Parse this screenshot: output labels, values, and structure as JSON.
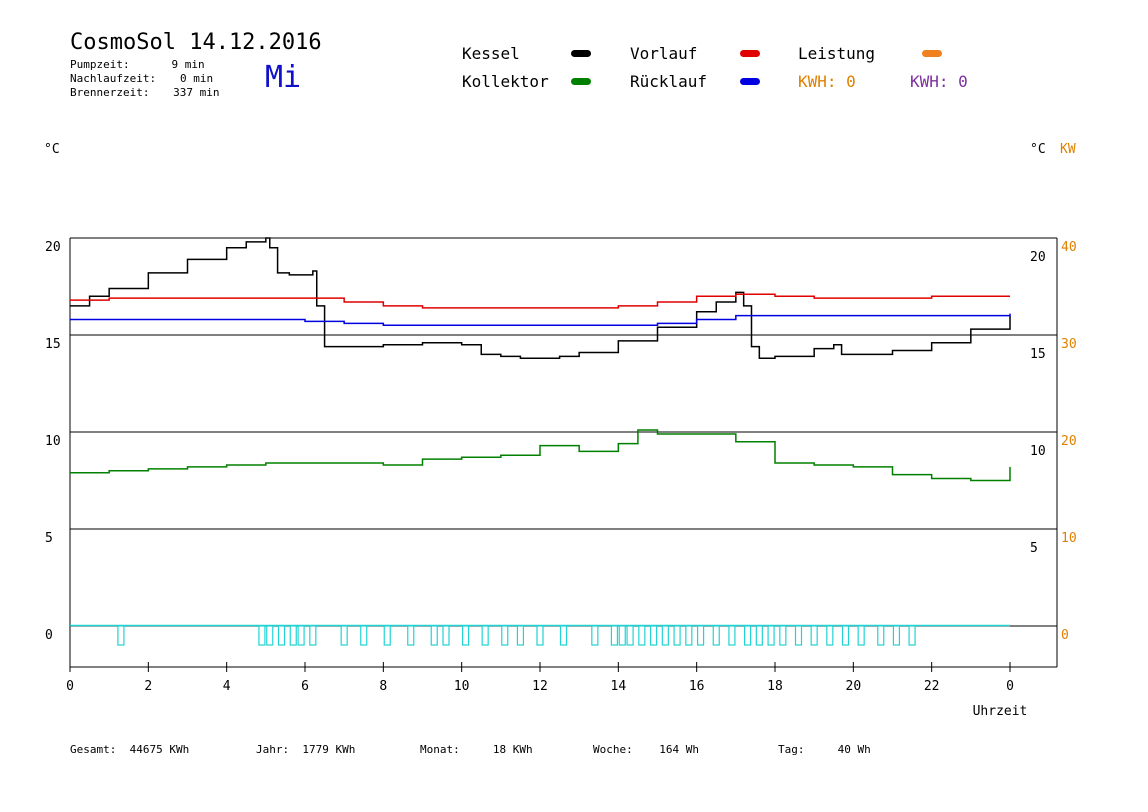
{
  "header": {
    "title": "CosmoSol 14.12.2016",
    "weekday": "Mi",
    "stats": [
      {
        "label": "Pumpzeit:",
        "value": "9 min"
      },
      {
        "label": "Nachlaufzeit:",
        "value": "0 min"
      },
      {
        "label": "Brennerzeit:",
        "value": "337 min"
      }
    ]
  },
  "legend": [
    {
      "label": "Kessel",
      "color": "#000000"
    },
    {
      "label": "Vorlauf",
      "color": "#e00000"
    },
    {
      "label": "Leistung",
      "color": "#f08020"
    },
    {
      "label": "Kollektor",
      "color": "#008000"
    },
    {
      "label": "Rücklauf",
      "color": "#0000e0"
    }
  ],
  "kwh": [
    {
      "text": "KWH: 0",
      "color": "#e08000"
    },
    {
      "text": "KWH: 0",
      "color": "#8030a0"
    }
  ],
  "units": {
    "left": "°C",
    "right_c": "°C",
    "right_kw": "KW"
  },
  "footer": [
    {
      "label": "Gesamt:",
      "value": "44675 KWh"
    },
    {
      "label": "Jahr:",
      "value": "1779 KWh"
    },
    {
      "label": "Monat:",
      "value": "18 KWh"
    },
    {
      "label": "Woche:",
      "value": "164 Wh"
    },
    {
      "label": "Tag:",
      "value": "40 Wh"
    }
  ],
  "chart_data": {
    "type": "line",
    "xlabel": "Uhrzeit",
    "xlim": [
      0,
      24
    ],
    "x_ticks": [
      "0",
      "2",
      "4",
      "6",
      "8",
      "10",
      "12",
      "14",
      "16",
      "18",
      "20",
      "22",
      "0"
    ],
    "ylim": [
      0,
      20
    ],
    "y_ticks_left": [
      "20",
      "15",
      "10",
      "5",
      "0"
    ],
    "y_ticks_right_c": [
      "20",
      "15",
      "10",
      "5"
    ],
    "y_ticks_right_kw": [
      "40",
      "30",
      "20",
      "10",
      "0"
    ],
    "grid_lines_y": [
      20,
      15,
      10,
      5,
      0
    ],
    "series": [
      {
        "name": "Kessel",
        "color": "#000000",
        "x": [
          0,
          0.5,
          1,
          2,
          3,
          4,
          4.5,
          5,
          5.1,
          5.3,
          5.6,
          6.2,
          6.3,
          6.5,
          7,
          8,
          9,
          10,
          10.5,
          11,
          11.5,
          12,
          12.5,
          13,
          14,
          15,
          16,
          16.5,
          17,
          17.2,
          17.4,
          17.6,
          18,
          19,
          19.5,
          19.7,
          20,
          21,
          22,
          23,
          24
        ],
        "y": [
          16.5,
          17.0,
          17.4,
          18.2,
          18.9,
          19.5,
          19.8,
          20.0,
          19.5,
          18.2,
          18.1,
          18.3,
          16.5,
          14.4,
          14.4,
          14.5,
          14.6,
          14.5,
          14.0,
          13.9,
          13.8,
          13.8,
          13.9,
          14.1,
          14.7,
          15.4,
          16.2,
          16.7,
          17.2,
          16.5,
          14.4,
          13.8,
          13.9,
          14.3,
          14.5,
          14.0,
          14.0,
          14.2,
          14.6,
          15.3,
          16.0
        ]
      },
      {
        "name": "Vorlauf",
        "color": "#e00000",
        "x": [
          0,
          1,
          2,
          4,
          6,
          7,
          8,
          9,
          10,
          11,
          12,
          13,
          14,
          15,
          16,
          17,
          18,
          19,
          20,
          21,
          22,
          23,
          24
        ],
        "y": [
          16.8,
          16.9,
          16.9,
          16.9,
          16.9,
          16.7,
          16.5,
          16.4,
          16.4,
          16.4,
          16.4,
          16.4,
          16.5,
          16.7,
          17.0,
          17.1,
          17.0,
          16.9,
          16.9,
          16.9,
          17.0,
          17.0,
          17.0
        ]
      },
      {
        "name": "Rücklauf",
        "color": "#0000e0",
        "x": [
          0,
          2,
          4,
          6,
          7,
          8,
          10,
          12,
          14,
          15,
          16,
          17,
          18,
          20,
          22,
          24
        ],
        "y": [
          15.8,
          15.8,
          15.8,
          15.7,
          15.6,
          15.5,
          15.5,
          15.5,
          15.5,
          15.6,
          15.8,
          16.0,
          16.0,
          16.0,
          16.0,
          16.1
        ]
      },
      {
        "name": "Kollektor",
        "color": "#008000",
        "x": [
          0,
          1,
          2,
          3,
          4,
          5,
          6,
          7,
          8,
          9,
          10,
          11,
          11.7,
          12,
          12.5,
          13,
          14,
          14.5,
          15,
          16,
          17,
          18,
          19,
          20,
          21,
          22,
          23,
          24
        ],
        "y": [
          7.9,
          8.0,
          8.1,
          8.2,
          8.3,
          8.4,
          8.4,
          8.4,
          8.3,
          8.6,
          8.7,
          8.8,
          8.8,
          9.3,
          9.3,
          9.0,
          9.4,
          10.1,
          9.9,
          9.9,
          9.5,
          8.4,
          8.3,
          8.2,
          7.8,
          7.6,
          7.5,
          8.2
        ]
      }
    ],
    "pump_pulses_x": [
      1.3,
      4.9,
      5.1,
      5.4,
      5.7,
      5.9,
      6.2,
      7.0,
      7.5,
      8.1,
      8.7,
      9.3,
      9.6,
      10.1,
      10.6,
      11.1,
      11.5,
      12.0,
      12.6,
      13.4,
      13.9,
      14.1,
      14.3,
      14.6,
      14.9,
      15.2,
      15.5,
      15.8,
      16.1,
      16.5,
      16.9,
      17.3,
      17.6,
      17.9,
      18.2,
      18.6,
      19.0,
      19.4,
      19.8,
      20.2,
      20.7,
      21.1,
      21.5
    ]
  }
}
